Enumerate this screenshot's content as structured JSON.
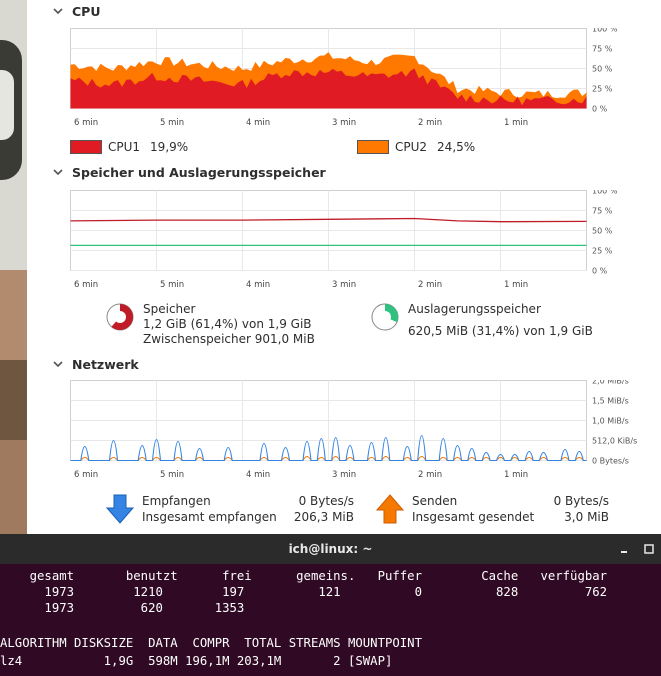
{
  "colors": {
    "cpu1": "#e01b24",
    "cpu2": "#ff7800",
    "memory": "#c01c28",
    "swap": "#2ec27e",
    "received": "#3584e4",
    "sent": "#f57900",
    "grid": "#e6e6e6",
    "terminal_bg": "#300a24"
  },
  "time_ticks": [
    "6 min",
    "5 min",
    "4 min",
    "3 min",
    "2 min",
    "1 min"
  ],
  "cpu": {
    "title": "CPU",
    "percent_ticks": [
      "100 %",
      "75 %",
      "50 %",
      "25 %",
      "0 %"
    ],
    "legend": [
      {
        "name": "CPU1",
        "value": "19,9%"
      },
      {
        "name": "CPU2",
        "value": "24,5%"
      }
    ]
  },
  "memory": {
    "title": "Speicher und Auslagerungsspeicher",
    "percent_ticks": [
      "100 %",
      "75 %",
      "50 %",
      "25 %",
      "0 %"
    ],
    "ram": {
      "label": "Speicher",
      "line1": "1,2 GiB (61,4%) von 1,9 GiB",
      "line2": "Zwischenspeicher 901,0 MiB",
      "percent": 61.4
    },
    "swap": {
      "label": "Auslagerungsspeicher",
      "line1": "620,5 MiB (31,4%) von 1,9 GiB",
      "percent": 31.4
    }
  },
  "network": {
    "title": "Netzwerk",
    "rate_ticks": [
      "2,0 MiB/s",
      "1,5 MiB/s",
      "1,0 MiB/s",
      "512,0 KiB/s",
      "0 Bytes/s"
    ],
    "received": {
      "label": "Empfangen",
      "rate": "0 Bytes/s",
      "total_label": "Insgesamt empfangen",
      "total": "206,3 MiB"
    },
    "sent": {
      "label": "Senden",
      "rate": "0 Bytes/s",
      "total_label": "Insgesamt gesendet",
      "total": "3,0 MiB"
    }
  },
  "chart_data": [
    {
      "type": "area",
      "title": "CPU",
      "x": [
        -360,
        -330,
        -300,
        -270,
        -240,
        -210,
        -180,
        -150,
        -120,
        -90,
        -60,
        -30,
        0
      ],
      "xlabel": "",
      "ylabel": "",
      "ylim": [
        0,
        100
      ],
      "series": [
        {
          "name": "CPU1",
          "values": [
            35,
            30,
            40,
            35,
            30,
            45,
            45,
            40,
            45,
            15,
            10,
            10,
            12
          ]
        },
        {
          "name": "CPU2",
          "values": [
            55,
            50,
            60,
            55,
            50,
            60,
            65,
            58,
            65,
            25,
            20,
            18,
            20
          ]
        }
      ]
    },
    {
      "type": "line",
      "title": "Speicher und Auslagerungsspeicher",
      "x": [
        -360,
        -300,
        -240,
        -180,
        -120,
        -90,
        -60,
        0
      ],
      "ylim": [
        0,
        100
      ],
      "series": [
        {
          "name": "Speicher",
          "values": [
            62,
            63,
            63,
            64,
            65,
            62,
            61,
            61.4
          ]
        },
        {
          "name": "Auslagerungsspeicher",
          "values": [
            31.4,
            31.4,
            31.4,
            31.4,
            31.4,
            31.4,
            31.4,
            31.4
          ]
        }
      ]
    },
    {
      "type": "line",
      "title": "Netzwerk",
      "x": [
        -350,
        -330,
        -310,
        -300,
        -285,
        -270,
        -250,
        -225,
        -210,
        -195,
        -185,
        -175,
        -165,
        -150,
        -140,
        -125,
        -115,
        -100,
        -90,
        -80,
        -70,
        -60,
        -50,
        -40,
        -30,
        -15,
        -5
      ],
      "ylim": [
        0,
        2.0
      ],
      "series": [
        {
          "name": "Empfangen",
          "values": [
            0.55,
            0.85,
            0.6,
            0.9,
            0.8,
            0.45,
            0.5,
            0.7,
            0.5,
            0.8,
            0.95,
            1.0,
            0.6,
            0.75,
            1.0,
            0.55,
            1.1,
            0.95,
            0.6,
            0.45,
            0.25,
            0.15,
            0.15,
            0.3,
            0.25,
            0.4,
            0.3
          ]
        },
        {
          "name": "Senden",
          "values": [
            0,
            0,
            0,
            0,
            0,
            0,
            0,
            0,
            0,
            0.05,
            0,
            0.05,
            0,
            0,
            0.05,
            0,
            0.05,
            0,
            0,
            0,
            0,
            0,
            0,
            0,
            0,
            0,
            0
          ]
        }
      ]
    }
  ],
  "terminal": {
    "title": "ich@linux: ~",
    "lines": [
      "    gesamt       benutzt      frei      gemeins.   Puffer        Cache   verfügbar",
      "      1973        1210        197          121          0          828         762",
      "      1973         620       1353",
      "",
      "ALGORITHM DISKSIZE  DATA  COMPR  TOTAL STREAMS MOUNTPOINT",
      "lz4           1,9G  598M 196,1M 203,1M       2 [SWAP]"
    ]
  }
}
